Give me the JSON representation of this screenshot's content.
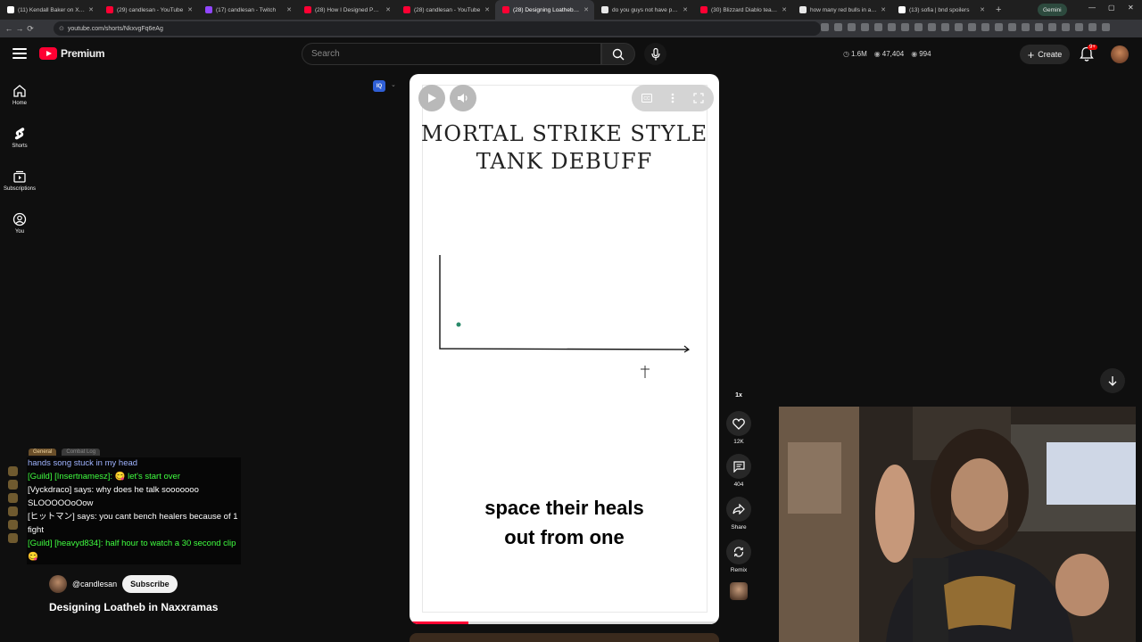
{
  "browser": {
    "tabs": [
      {
        "title": "(11) Kendall Baker on X: \"Alt",
        "favicon_color": "#ffffff"
      },
      {
        "title": "(29) candlesan - YouTube",
        "favicon_color": "#ff0033"
      },
      {
        "title": "(17) candlesan - Twitch",
        "favicon_color": "#9146ff"
      },
      {
        "title": "(28) How I Designed Patchw",
        "favicon_color": "#ff0033"
      },
      {
        "title": "(28) candlesan - YouTube",
        "favicon_color": "#ff0033"
      },
      {
        "title": "(28) Designing Loatheb in N",
        "favicon_color": "#ff0033",
        "active": true
      },
      {
        "title": "do you guys not have phon",
        "favicon_color": "#e8e8e8"
      },
      {
        "title": "(30) Blizzard Diablo team b",
        "favicon_color": "#ff0033"
      },
      {
        "title": "how many red bulls in a cra",
        "favicon_color": "#e8e8e8"
      },
      {
        "title": "(13) sofia | bnd spoilers",
        "favicon_color": "#ffffff"
      }
    ],
    "gemini_label": "Gemini",
    "url": "youtube.com/shorts/NkxvgFq6eAg"
  },
  "header": {
    "brand": "Premium",
    "search_placeholder": "Search",
    "stats": [
      {
        "icon": "clock-icon",
        "value": "1.6M"
      },
      {
        "icon": "eye-icon",
        "value": "47,404"
      },
      {
        "icon": "eye-icon",
        "value": "994"
      }
    ],
    "create_label": "Create",
    "notification_count": "9+"
  },
  "nav": {
    "items": [
      {
        "label": "Home",
        "icon": "home-icon"
      },
      {
        "label": "Shorts",
        "icon": "shorts-icon"
      },
      {
        "label": "Subscriptions",
        "icon": "subscriptions-icon"
      },
      {
        "label": "You",
        "icon": "you-icon"
      }
    ]
  },
  "short": {
    "board_title_line1": "MORTAL STRIKE STYLE",
    "board_title_line2": "TANK DEBUFF",
    "caption_line1": "space their heals",
    "caption_line2": "out from one",
    "progress_fraction": 0.19
  },
  "actions": {
    "speed": "1x",
    "like_count": "12K",
    "comment_count": "404",
    "share_label": "Share",
    "remix_label": "Remix"
  },
  "chat": {
    "tabs": [
      "General",
      "Combat Log"
    ],
    "lines": [
      {
        "text": "hands song stuck in my head",
        "kind": "faded"
      },
      {
        "text": "[Guild] [Insertnamesz]: 😋 let's start over",
        "kind": "guild"
      },
      {
        "text": "[Vyckdraco] says: why does he talk sooooooo SLOOOOOoOow",
        "kind": "whisper"
      },
      {
        "text": "[ヒットマン] says: you cant bench healers because of 1 fight",
        "kind": "whisper"
      },
      {
        "text": "[Guild] [heavyd834]: half hour to watch a 30 second clip 😋",
        "kind": "guild"
      }
    ]
  },
  "channel": {
    "handle": "@candlesan",
    "subscribe_label": "Subscribe",
    "video_title": "Designing Loatheb in Naxxramas"
  }
}
